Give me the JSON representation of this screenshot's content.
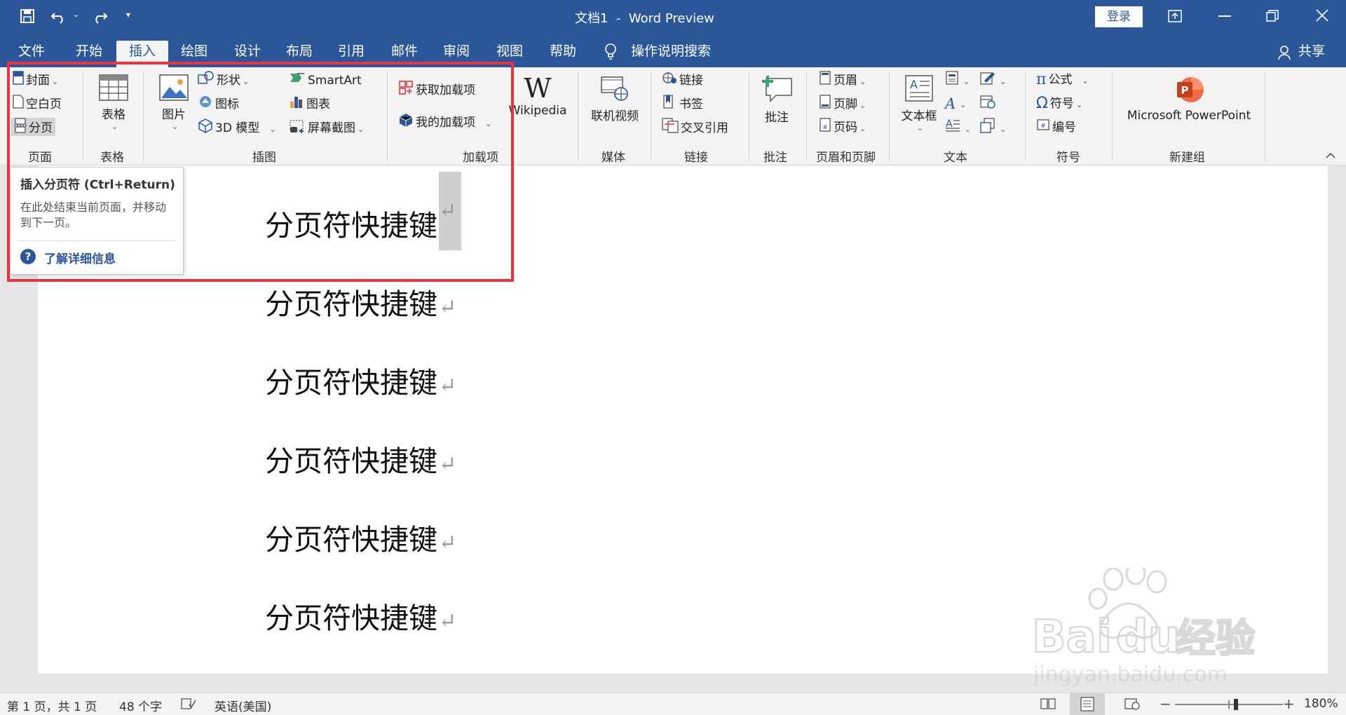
{
  "window": {
    "title": "文档1  -  Word Preview",
    "login_label": "登录"
  },
  "quick_access": {
    "icons": [
      "save-icon",
      "undo-icon",
      "redo-icon",
      "customize-icon"
    ]
  },
  "tabs": [
    {
      "label": "文件"
    },
    {
      "label": "开始"
    },
    {
      "label": "插入",
      "active": true
    },
    {
      "label": "绘图"
    },
    {
      "label": "设计"
    },
    {
      "label": "布局"
    },
    {
      "label": "引用"
    },
    {
      "label": "邮件"
    },
    {
      "label": "审阅"
    },
    {
      "label": "视图"
    },
    {
      "label": "帮助"
    }
  ],
  "search": {
    "label": "操作说明搜索"
  },
  "share": {
    "label": "共享"
  },
  "ribbon": {
    "pages": {
      "cover": "封面",
      "blank": "空白页",
      "break": "分页",
      "group": "页面"
    },
    "tables": {
      "table": "表格",
      "group": "表格"
    },
    "illustrations": {
      "picture": "图片",
      "shapes": "形状",
      "icons": "图标",
      "model3d": "3D 模型",
      "smartart": "SmartArt",
      "chart": "图表",
      "screenshot": "屏幕截图",
      "group": "插图"
    },
    "addins": {
      "get": "获取加载项",
      "mine": "我的加载项",
      "wikipedia": "Wikipedia",
      "group": "加载项"
    },
    "media": {
      "video": "联机视频",
      "group": "媒体"
    },
    "links": {
      "link": "链接",
      "bookmark": "书签",
      "crossref": "交叉引用",
      "group": "链接"
    },
    "comments": {
      "comment": "批注",
      "group": "批注"
    },
    "headerfooter": {
      "header": "页眉",
      "footer": "页脚",
      "pagenum": "页码",
      "group": "页眉和页脚"
    },
    "text": {
      "textbox": "文本框",
      "group": "文本"
    },
    "symbols": {
      "equation": "公式",
      "symbol": "符号",
      "number": "编号",
      "group": "符号"
    },
    "newgroup": {
      "ppt": "Microsoft PowerPoint",
      "group": "新建组"
    }
  },
  "tooltip": {
    "title": "插入分页符 (Ctrl+Return)",
    "body": "在此处结束当前页面，并移动到下一页。",
    "link": "了解详细信息"
  },
  "document": {
    "lines": [
      "分页符快捷键",
      "分页符快捷键",
      "分页符快捷键",
      "分页符快捷键",
      "分页符快捷键",
      "分页符快捷键"
    ],
    "return_mark": "↵"
  },
  "status": {
    "page": "第 1 页，共 1 页",
    "words": "48 个字",
    "language": "英语(美国)",
    "zoom": "180%"
  },
  "watermark": {
    "text": "Baidu经验",
    "url": "jingyan.baidu.com"
  },
  "colors": {
    "accent": "#2b579a",
    "highlight": "#e8343f"
  }
}
